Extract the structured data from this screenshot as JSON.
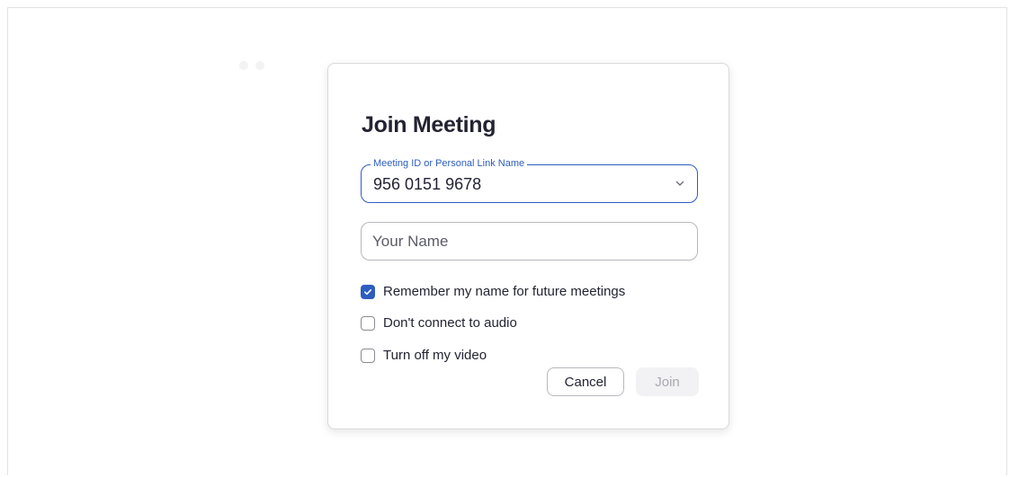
{
  "dialog": {
    "title": "Join Meeting",
    "meeting_id_field": {
      "label": "Meeting ID or Personal Link Name",
      "value": "956 0151 9678"
    },
    "name_field": {
      "placeholder": "Your Name",
      "value": ""
    },
    "options": [
      {
        "label": "Remember my name for future meetings",
        "checked": true
      },
      {
        "label": "Don't connect to audio",
        "checked": false
      },
      {
        "label": "Turn off my video",
        "checked": false
      }
    ],
    "buttons": {
      "cancel": "Cancel",
      "join": "Join"
    }
  },
  "colors": {
    "accent": "#2d5dbf",
    "title_text": "#232333",
    "disabled_button_bg": "#f2f2f4",
    "disabled_button_text": "#a8a8b0"
  }
}
